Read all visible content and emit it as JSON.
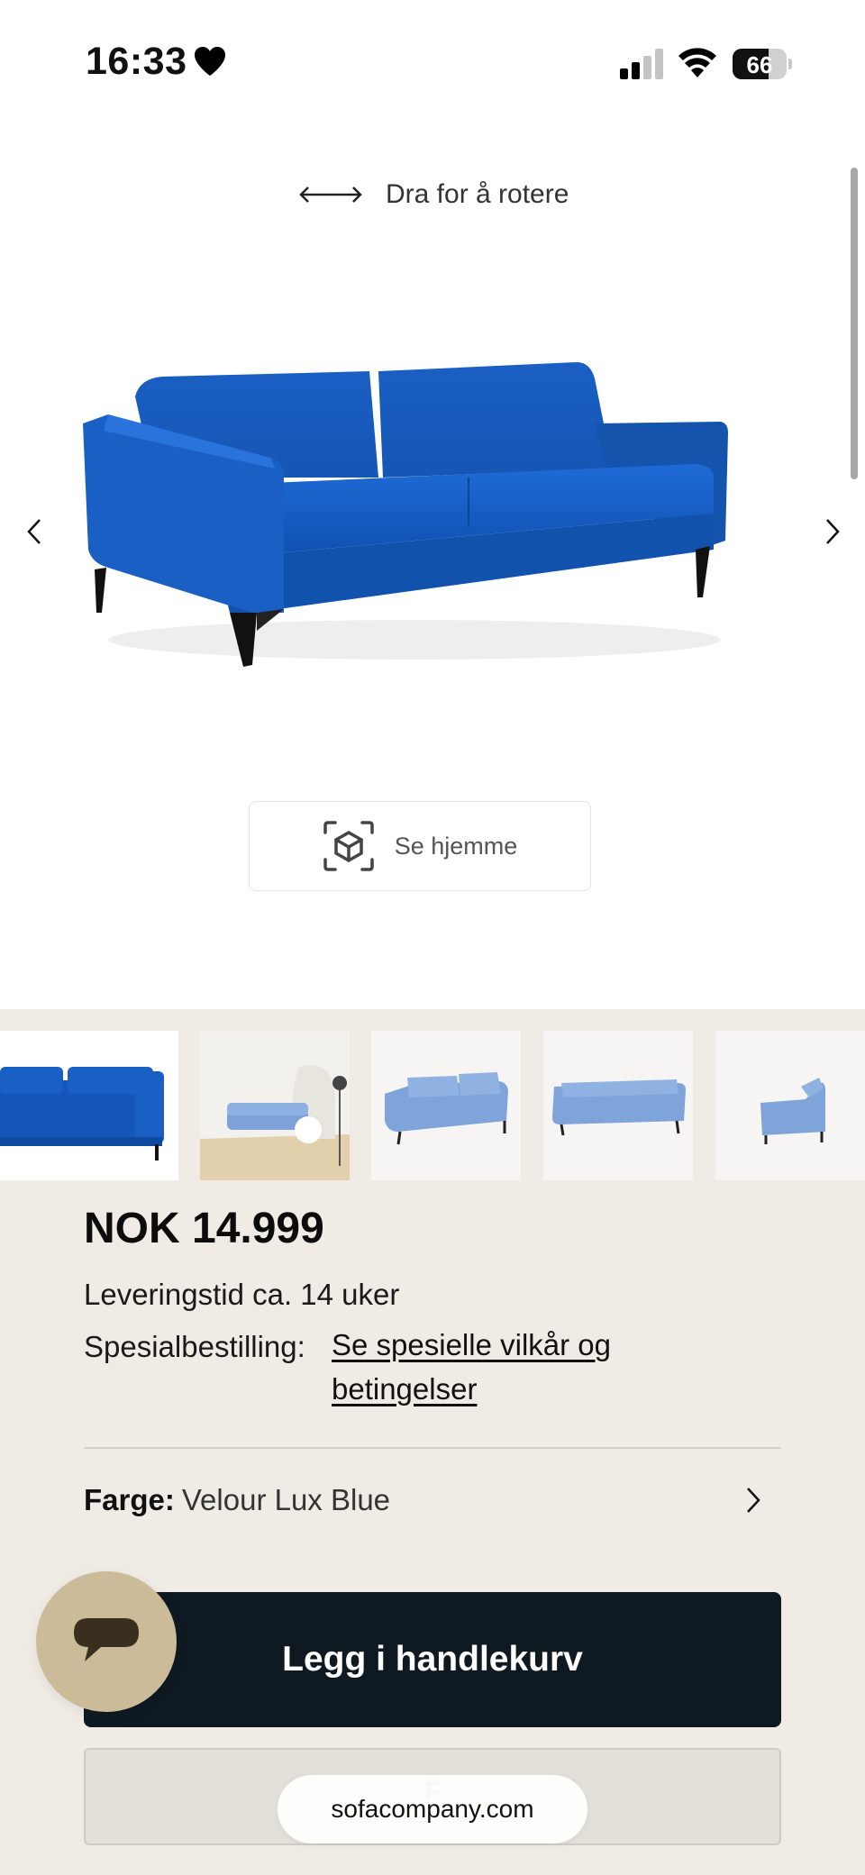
{
  "status_bar": {
    "time": "16:33",
    "battery_level": "66",
    "battery_fraction": 0.66
  },
  "viewer": {
    "rotate_hint": "Dra for å rotere",
    "ar_button_label": "Se hjemme",
    "product_color_hex": "#1a5fc4"
  },
  "thumbnails": [
    {
      "name": "front view",
      "active": true
    },
    {
      "name": "room scene",
      "active": false
    },
    {
      "name": "angled view",
      "active": false
    },
    {
      "name": "back view",
      "active": false
    },
    {
      "name": "side view",
      "active": false
    }
  ],
  "product": {
    "price": "NOK 14.999",
    "delivery": "Leveringstid ca. 14 uker",
    "special_order_label": "Spesialbestilling:",
    "special_order_link": "Se spesielle vilkår og betingelser",
    "color_label": "Farge:",
    "color_value": "Velour Lux Blue"
  },
  "actions": {
    "add_to_cart": "Legg i handlekurv",
    "secondary_button_partial": "F"
  },
  "browser": {
    "url": "sofacompany.com"
  },
  "colors": {
    "panel_bg": "#f0ece5",
    "cart_button_bg": "#0f1921",
    "chat_button_bg": "#cbbb99"
  }
}
